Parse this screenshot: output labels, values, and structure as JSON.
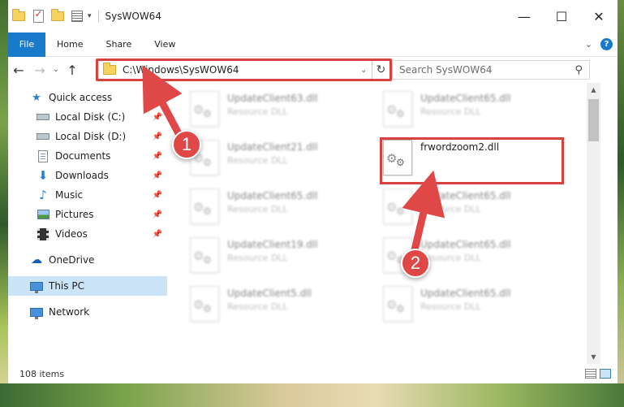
{
  "window": {
    "title": "SysWOW64",
    "minimize": "—",
    "maximize": "☐",
    "close": "✕"
  },
  "ribbon": {
    "tabs": [
      "File",
      "Home",
      "Share",
      "View"
    ],
    "expand": "⌄",
    "help": "?"
  },
  "nav": {
    "back": "←",
    "forward": "→",
    "recent": "⌄",
    "up": "↑",
    "address": "C:\\Windows\\SysWOW64",
    "address_dropdown": "⌄",
    "refresh": "↻",
    "search_placeholder": "Search SysWOW64",
    "search_icon": "⚲"
  },
  "sidebar": {
    "quick_access": "Quick access",
    "items": [
      {
        "label": "Local Disk (C:)",
        "icon": "drive-icon",
        "pinned": true
      },
      {
        "label": "Local Disk (D:)",
        "icon": "drive-icon",
        "pinned": true
      },
      {
        "label": "Documents",
        "icon": "documents-icon",
        "pinned": true
      },
      {
        "label": "Downloads",
        "icon": "downloads-icon",
        "pinned": true
      },
      {
        "label": "Music",
        "icon": "music-icon",
        "pinned": true
      },
      {
        "label": "Pictures",
        "icon": "pictures-icon",
        "pinned": true
      },
      {
        "label": "Videos",
        "icon": "videos-icon",
        "pinned": true
      }
    ],
    "onedrive": "OneDrive",
    "this_pc": "This PC",
    "network": "Network",
    "pin_glyph": "📌"
  },
  "files": [
    {
      "name": "UpdateClient63.dll",
      "type": "Resource DLL",
      "blurred": true
    },
    {
      "name": "UpdateClient65.dll",
      "type": "Resource DLL",
      "blurred": true
    },
    {
      "name": "UpdateClient21.dll",
      "type": "Resource DLL",
      "blurred": true
    },
    {
      "name": "frwordzoom2.dll",
      "type": "",
      "blurred": false
    },
    {
      "name": "UpdateClient65.dll",
      "type": "Resource DLL",
      "blurred": true
    },
    {
      "name": "UpdateClient65.dll",
      "type": "Resource DLL",
      "blurred": true
    },
    {
      "name": "UpdateClient19.dll",
      "type": "Resource DLL",
      "blurred": true
    },
    {
      "name": "UpdateClient65.dll",
      "type": "Resource DLL",
      "blurred": true
    },
    {
      "name": "UpdateClient5.dll",
      "type": "Resource DLL",
      "blurred": true
    },
    {
      "name": "UpdateClient65.dll",
      "type": "Resource DLL",
      "blurred": true
    }
  ],
  "status": {
    "item_count": "108 items"
  },
  "annotations": {
    "step1": "1",
    "step2": "2",
    "color": "#e04848"
  },
  "colors": {
    "accent": "#1979ca",
    "selection": "#cce4f7",
    "highlight": "#d94040"
  }
}
